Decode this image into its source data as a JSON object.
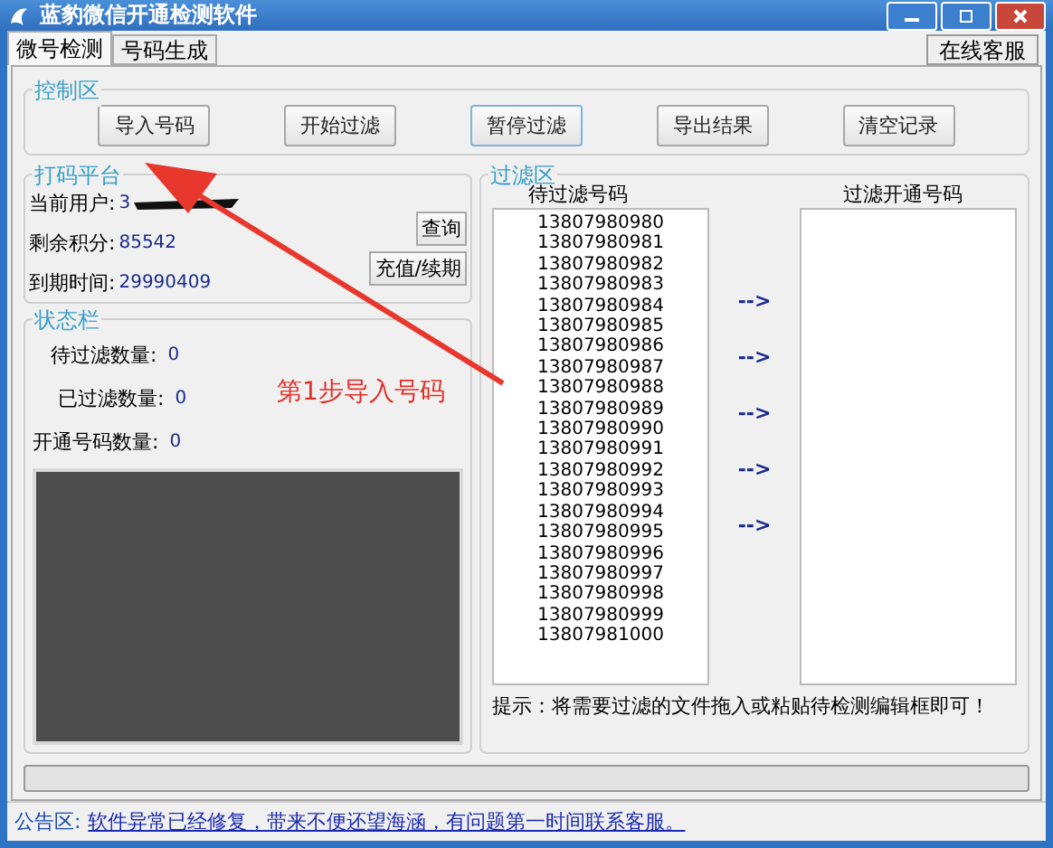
{
  "window": {
    "title": "蓝豹微信开通检测软件"
  },
  "tabs": [
    {
      "label": "微号检测",
      "selected": true
    },
    {
      "label": "号码生成",
      "selected": false
    }
  ],
  "support_button": "在线客服",
  "control": {
    "title": "控制区",
    "buttons": [
      {
        "label": "导入号码",
        "focused": false
      },
      {
        "label": "开始过滤",
        "focused": false
      },
      {
        "label": "暂停过滤",
        "focused": true
      },
      {
        "label": "导出结果",
        "focused": false
      },
      {
        "label": "清空记录",
        "focused": false
      }
    ]
  },
  "platform": {
    "title": "打码平台",
    "user_label": "当前用户:",
    "user_value": "3",
    "points_label": "剩余积分:",
    "points_value": "85542",
    "expiry_label": "到期时间:",
    "expiry_value": "29990409",
    "query_button": "查询",
    "recharge_button": "充值/续期"
  },
  "status": {
    "title": "状态栏",
    "rows": [
      {
        "label": "待过滤数量:",
        "value": "0"
      },
      {
        "label": "已过滤数量:",
        "value": "0"
      },
      {
        "label": "开通号码数量:",
        "value": "0"
      }
    ]
  },
  "filter": {
    "title": "过滤区",
    "pending_header": "待过滤号码",
    "opened_header": "过滤开通号码",
    "pending": [
      "13807980980",
      "13807980981",
      "13807980982",
      "13807980983",
      "13807980984",
      "13807980985",
      "13807980986",
      "13807980987",
      "13807980988",
      "13807980989",
      "13807980990",
      "13807980991",
      "13807980992",
      "13807980993",
      "13807980994",
      "13807980995",
      "13807980996",
      "13807980997",
      "13807980998",
      "13807980999",
      "13807981000"
    ],
    "arrows": [
      "-->",
      "-->",
      "-->",
      "-->",
      "-->"
    ],
    "hint": "提示：将需要过滤的文件拖入或粘贴待检测编辑框即可！"
  },
  "progress": {
    "level": 0
  },
  "notice": {
    "label": "公告区:",
    "text": "软件异常已经修复，带来不便还望海涵，有问题第一时间联系客服。"
  },
  "annotation": {
    "text": "第1步导入号码"
  }
}
